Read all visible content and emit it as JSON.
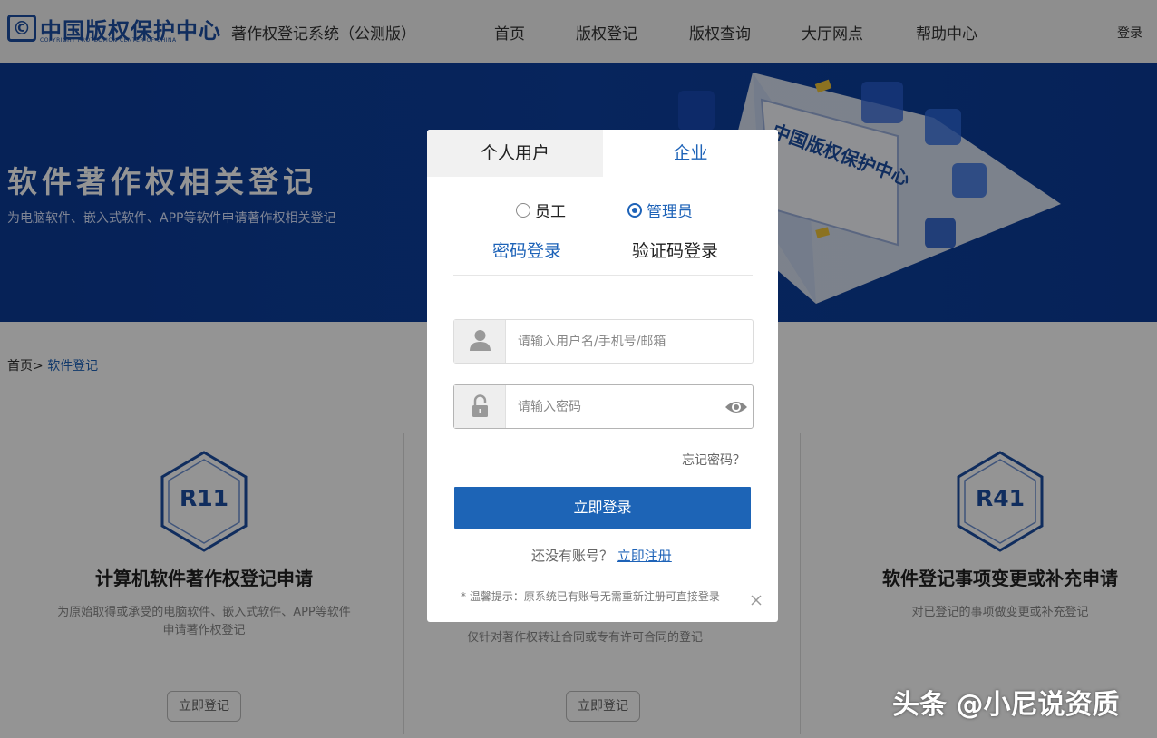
{
  "header": {
    "logo_title": "中国版权保护中心",
    "logo_sub": "COPYRIGHT PROTECTION CENTER OF CHINA",
    "system_name": "著作权登记系统（公测版）",
    "nav": [
      "首页",
      "版权登记",
      "版权查询",
      "大厅网点",
      "帮助中心"
    ],
    "login": "登录"
  },
  "banner": {
    "title": "软件著作权相关登记",
    "subtitle": "为电脑软件、嵌入式软件、APP等软件申请著作权相关登记"
  },
  "breadcrumb": {
    "home": "首页>",
    "current": "软件登记"
  },
  "cards": [
    {
      "code": "R11",
      "title": "计算机软件著作权登记申请",
      "desc": "为原始取得或承受的电脑软件、嵌入式软件、APP等软件申请著作权登记",
      "button": "立即登记"
    },
    {
      "code": "",
      "title": "",
      "desc": "仅针对著作权转让合同或专有许可合同的登记",
      "button": "立即登记"
    },
    {
      "code": "R41",
      "title": "软件登记事项变更或补充申请",
      "desc": "对已登记的事项做变更或补充登记",
      "button": ""
    }
  ],
  "modal": {
    "tabs": [
      "个人用户",
      "企业"
    ],
    "roles": [
      "员工",
      "管理员"
    ],
    "modes": [
      "密码登录",
      "验证码登录"
    ],
    "username_placeholder": "请输入用户名/手机号/邮箱",
    "password_placeholder": "请输入密码",
    "forgot": "忘记密码？",
    "submit": "立即登录",
    "no_account": "还没有账号？",
    "register": "立即注册",
    "tip": "* 温馨提示：原系统已有账号无需重新注册可直接登录"
  },
  "watermark": "头条 @小尼说资质",
  "colors": {
    "accent": "#1e63b8",
    "banner": "#0d40a0",
    "submit": "#1d64b6"
  }
}
